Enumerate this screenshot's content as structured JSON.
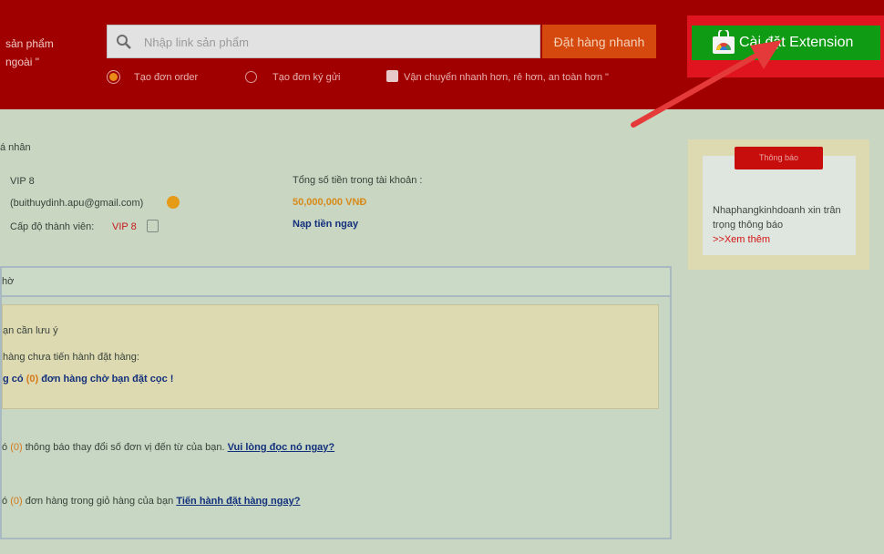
{
  "header": {
    "left_line1": "sản phẩm",
    "left_line2": "ngoài \"",
    "search_placeholder": "Nhập link sản phẩm",
    "quick_order_label": "Đặt hàng nhanh",
    "radio_option1": "Tạo đơn order",
    "radio_option2": "Tạo đơn ký gửi",
    "shipping_note": "Vận chuyển nhanh hơn, rẻ hơn, an toàn hơn \"",
    "extension_button_label": "Cài đặt Extension"
  },
  "account": {
    "section_title": "á nhân",
    "vip_line": "VIP 8",
    "email": "(buithuydinh.apu@gmail.com)",
    "level_label": "Cấp độ thành viên:",
    "level_value": "VIP 8",
    "balance_label": "Tổng số tiền trong tài khoản :",
    "balance_value": "50,000,000 VNĐ",
    "topup_link": "Nạp tiền ngay"
  },
  "panel": {
    "header_title": "hờ",
    "notice_title": "ạn cần lưu ý",
    "notice_line1": "hàng chưa tiến hành đặt hàng:",
    "notice_line2_prefix": "g có",
    "notice_line2_count": "(0)",
    "notice_line2_suffix": "đơn hàng chờ bạn đặt cọc !",
    "row1_prefix": "ó",
    "row1_count": "(0)",
    "row1_text": "thông báo thay đổi số đơn vị đến từ của bạn.",
    "row1_link": "Vui lòng đọc nó ngay?",
    "row2_prefix": "ó",
    "row2_count": "(0)",
    "row2_text": "đơn hàng trong giỏ hàng của bạn",
    "row2_link": "Tiến hành đặt hàng ngay?"
  },
  "side_notice": {
    "title": "Thông báo",
    "text": "Nhaphangkinhdoanh xin trân trọng thông báo",
    "more": ">>Xem thêm"
  },
  "colors": {
    "header_bg": "#a10000",
    "extension_green": "#0f9b14",
    "highlight_red": "#e0141e",
    "page_bg": "#c8d6c2"
  }
}
